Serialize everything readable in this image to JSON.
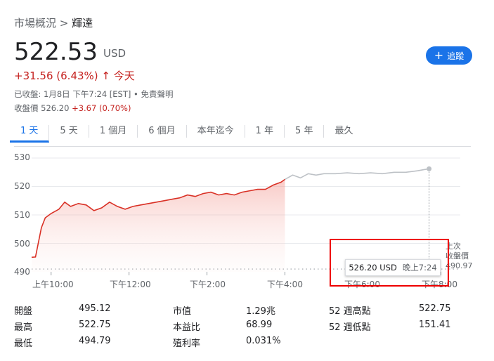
{
  "breadcrumb": {
    "parent": "市場概況",
    "sep": ">",
    "current": "輝達"
  },
  "quote": {
    "price": "522.53",
    "currency": "USD",
    "change": "+31.56 (6.43%)",
    "arrow": "↑",
    "period": "今天"
  },
  "meta": {
    "line1": "已收盤: 1月8日 下午7:24 [EST] • 免責聲明",
    "line2_label": "收盤價 526.20",
    "line2_change": "+3.67 (0.70%)"
  },
  "follow": {
    "icon": "plus-icon",
    "label": "追蹤"
  },
  "tabs": [
    "1 天",
    "5 天",
    "1 個月",
    "6 個月",
    "本年迄今",
    "1 年",
    "5 年",
    "最久"
  ],
  "chart_data": {
    "type": "line",
    "y_ticks": [
      "530",
      "520",
      "510",
      "500",
      "490"
    ],
    "ylim": [
      490,
      530
    ],
    "x_ticks": [
      "上午10:00",
      "下午12:00",
      "下午2:00",
      "下午4:00",
      "下午6:00",
      "下午8:00"
    ],
    "x_tick_hours": [
      10,
      12,
      14,
      16,
      18,
      20
    ],
    "xlim": [
      9.5,
      20.5
    ],
    "previous_close_label": [
      "上次",
      "收盤價",
      "490.97"
    ],
    "previous_close": 490.97,
    "series": [
      {
        "session": "regular",
        "color": "#d93025",
        "x": [
          9.5,
          9.6,
          9.75,
          9.85,
          10.0,
          10.2,
          10.35,
          10.5,
          10.7,
          10.9,
          11.1,
          11.3,
          11.5,
          11.7,
          11.9,
          12.1,
          12.3,
          12.5,
          12.7,
          12.9,
          13.1,
          13.3,
          13.5,
          13.7,
          13.9,
          14.1,
          14.3,
          14.5,
          14.7,
          14.9,
          15.1,
          15.3,
          15.5,
          15.7,
          15.9,
          16.0
        ],
        "y": [
          495.1,
          495.2,
          505.5,
          509.0,
          510.5,
          512.0,
          514.5,
          513.0,
          514.0,
          513.5,
          511.5,
          512.5,
          514.5,
          513.0,
          512.0,
          513.0,
          513.5,
          514.0,
          514.5,
          515.0,
          515.5,
          516.0,
          517.0,
          516.5,
          517.5,
          518.0,
          517.0,
          517.5,
          517.0,
          518.0,
          518.5,
          519.0,
          519.0,
          520.5,
          521.5,
          522.5
        ]
      },
      {
        "session": "after-hours",
        "color": "#bdc1c6",
        "x": [
          16.0,
          16.2,
          16.4,
          16.6,
          16.8,
          17.0,
          17.3,
          17.6,
          17.9,
          18.2,
          18.5,
          18.8,
          19.1,
          19.4,
          19.6,
          19.7
        ],
        "y": [
          522.5,
          524.0,
          523.0,
          524.5,
          524.0,
          524.5,
          524.5,
          524.8,
          524.5,
          524.8,
          524.5,
          525.0,
          525.0,
          525.5,
          526.0,
          526.2
        ]
      }
    ],
    "tooltip": {
      "value": "526.20 USD",
      "time": "晚上7:24"
    }
  },
  "stats": [
    {
      "label": "開盤",
      "value": "495.12"
    },
    {
      "label": "最高",
      "value": "522.75"
    },
    {
      "label": "最低",
      "value": "494.79"
    },
    {
      "label": "市值",
      "value": "1.29兆"
    },
    {
      "label": "本益比",
      "value": "68.99"
    },
    {
      "label": "殖利率",
      "value": "0.031%"
    },
    {
      "label": "52 週高點",
      "value": "522.75"
    },
    {
      "label": "52 週低點",
      "value": "151.41"
    }
  ]
}
